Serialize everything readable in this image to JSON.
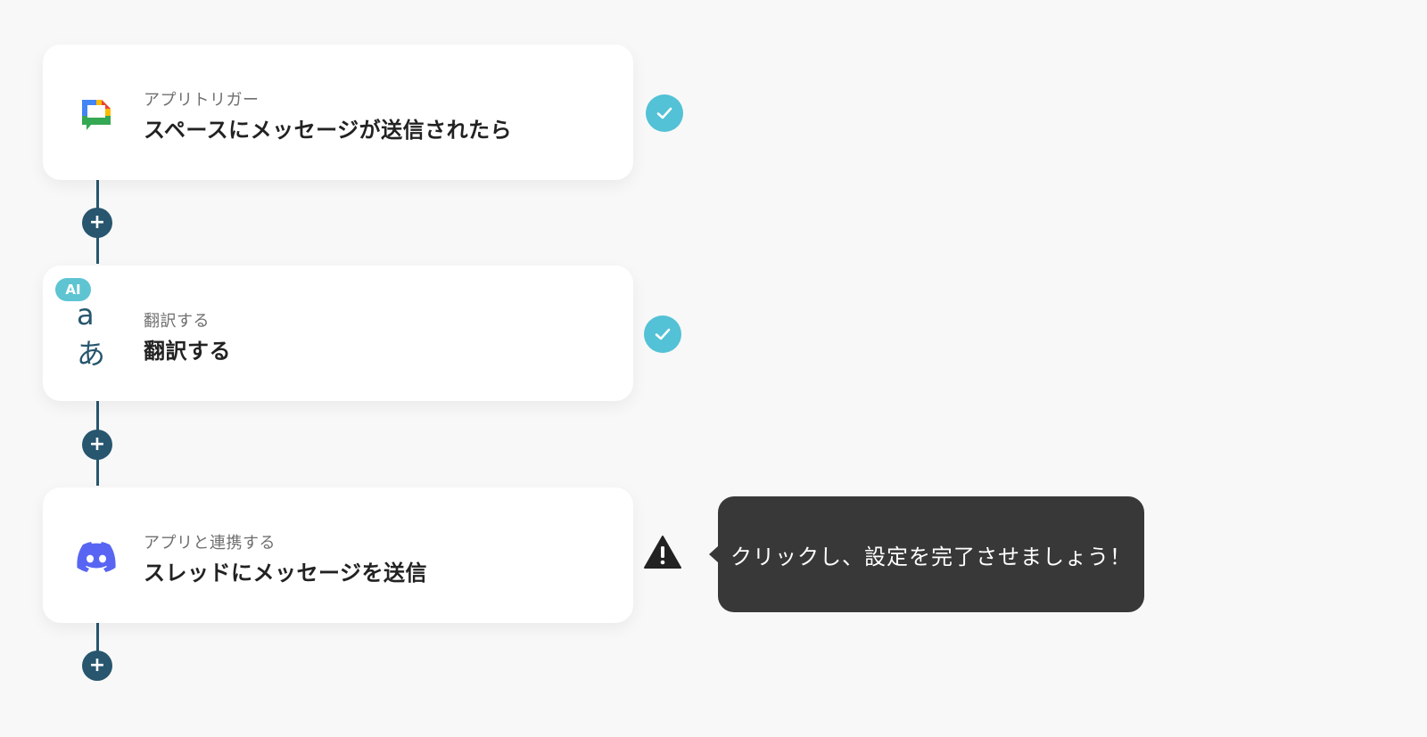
{
  "steps": [
    {
      "subtitle": "アプリトリガー",
      "title": "スペースにメッセージが送信されたら",
      "icon": "google-chat-icon",
      "status": "complete"
    },
    {
      "badge": "AI",
      "subtitle": "翻訳する",
      "title": "翻訳する",
      "icon": "translate-icon",
      "icon_glyph": "aあ",
      "status": "complete"
    },
    {
      "subtitle": "アプリと連携する",
      "title": "スレッドにメッセージを送信",
      "icon": "discord-icon",
      "status": "warning"
    }
  ],
  "add_button_glyph": "+",
  "tooltip": {
    "text": "クリックし、設定を完了させましょう！"
  },
  "colors": {
    "connector": "#27566e",
    "check": "#53c1d6",
    "ai_badge": "#5ec4d2",
    "tooltip_bg": "#383838",
    "discord": "#5865f2"
  }
}
